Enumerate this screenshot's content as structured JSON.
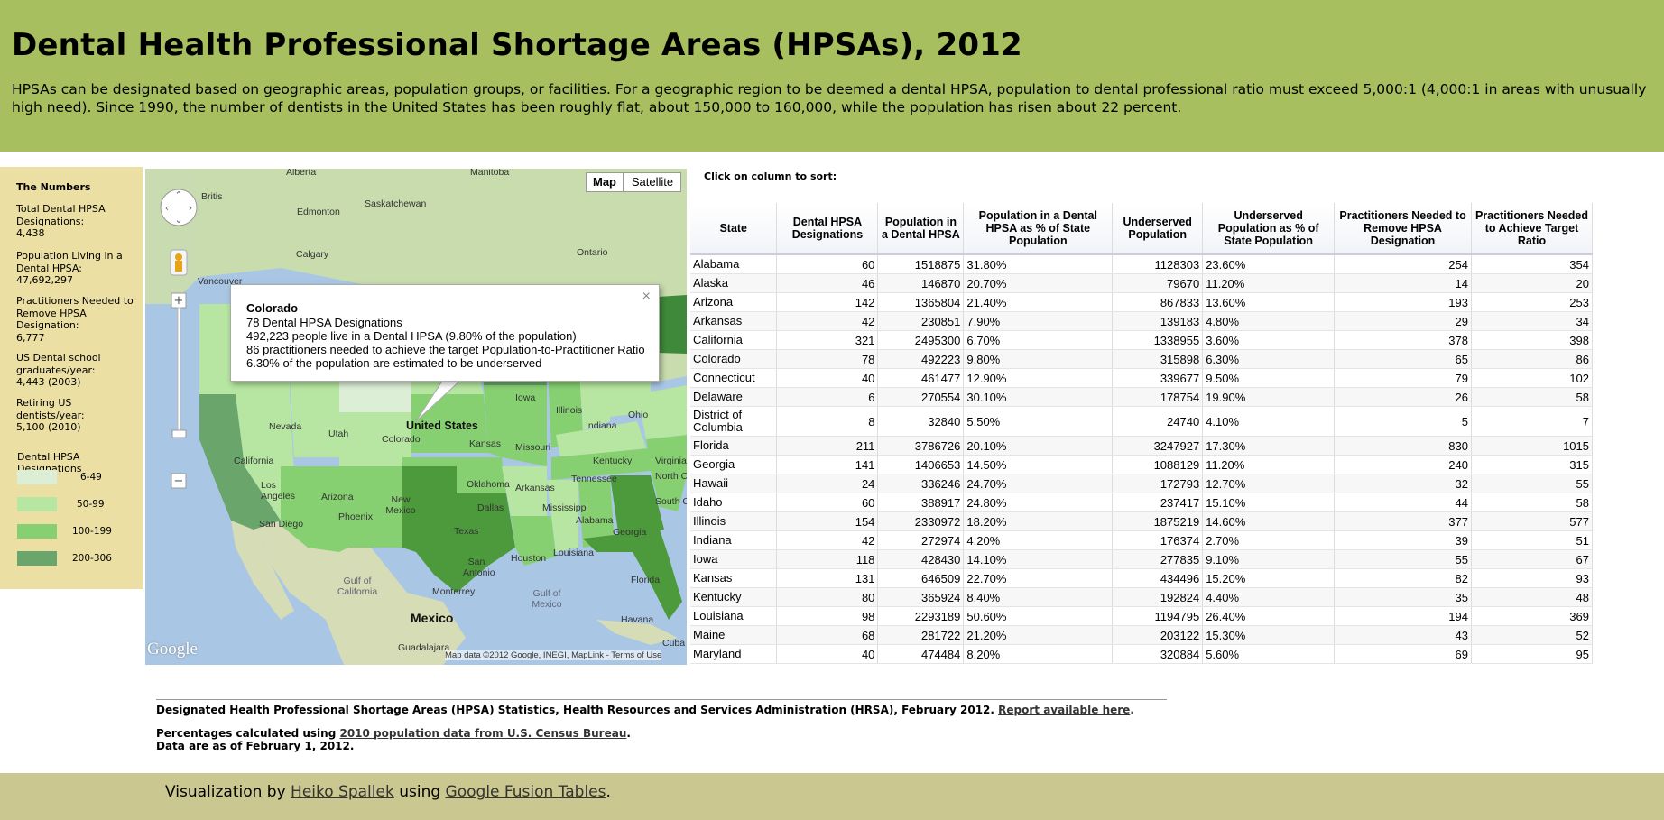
{
  "header": {
    "title": "Dental Health Professional Shortage Areas (HPSAs), 2012",
    "intro": "HPSAs can be designated based on geographic areas, population groups, or facilities. For a geographic region to be deemed a dental HPSA, population to dental professional ratio must exceed 5,000:1 (4,000:1 in areas with unusually high need). Since 1990, the number of dentists in the United States has been roughly flat, about 150,000 to 160,000, while the population has risen about 22 percent."
  },
  "numbers": {
    "heading": "The Numbers",
    "stats": [
      {
        "label": "Total Dental HPSA Designations:",
        "value": "4,438"
      },
      {
        "label": "Population Living in a Dental HPSA:",
        "value": "47,692,297"
      },
      {
        "label": "Practitioners Needed to Remove HPSA Designation:",
        "value": "6,777"
      },
      {
        "label": "US Dental school graduates/year:",
        "value": "4,443 (2003)"
      },
      {
        "label": "Retiring US dentists/year:",
        "value": "5,100 (2010)"
      }
    ],
    "legend": {
      "title": "Dental HPSA Designations",
      "items": [
        {
          "label": "6-49",
          "color": "#dcefd6"
        },
        {
          "label": "50-99",
          "color": "#b6e6a1"
        },
        {
          "label": "100-199",
          "color": "#87d071"
        },
        {
          "label": "200-306",
          "color": "#6aa56b"
        }
      ]
    }
  },
  "map": {
    "type_buttons": {
      "map": "Map",
      "satellite": "Satellite"
    },
    "labels": [
      "Alberta",
      "Manitoba",
      "Saskatchewan",
      "Edmonton",
      "British Columbia",
      "Calgary",
      "Ontario",
      "Vancouver",
      "Nevada",
      "Utah",
      "Colorado",
      "United States",
      "Kansas",
      "Missouri",
      "Iowa",
      "Illinois",
      "Indiana",
      "Ohio",
      "California",
      "Los Angeles",
      "Arizona",
      "Phoenix",
      "New Mexico",
      "Oklahoma",
      "Arkansas",
      "Tennessee",
      "Kentucky",
      "Virginia",
      "North Carolina",
      "South Carolina",
      "Mississippi",
      "Alabama",
      "Georgia",
      "Louisiana",
      "Texas",
      "Dallas",
      "San Antonio",
      "Houston",
      "Florida",
      "San Diego",
      "Gulf of California",
      "Monterrey",
      "Gulf of Mexico",
      "Mexico",
      "Havana",
      "Guadalajara",
      "Cuba"
    ],
    "attribution": "Map data ©2012 Google, INEGI, MapLink - ",
    "terms": "Terms of Use",
    "logo": "Google",
    "info_window": {
      "title": "Colorado",
      "lines": [
        "78 Dental HPSA Designations",
        "492,223 people live in a Dental HPSA (9.80% of the population)",
        "86 practitioners needed to achieve the target Population-to-Practitioner Ratio",
        "6.30% of the population are estimated to be underserved"
      ],
      "close": "×"
    }
  },
  "table": {
    "sort_hint": "Click on column to sort:",
    "columns": [
      "State",
      "Dental HPSA Designations",
      "Population in a Dental HPSA",
      "Population in a Dental HPSA as % of State Population",
      "Underserved Population",
      "Underserved Population as % of State Population",
      "Practitioners Needed to Remove HPSA Designation",
      "Practitioners Needed to Achieve Target Ratio"
    ],
    "rows": [
      [
        "Alabama",
        "60",
        "1518875",
        "31.80%",
        "1128303",
        "23.60%",
        "254",
        "354"
      ],
      [
        "Alaska",
        "46",
        "146870",
        "20.70%",
        "79670",
        "11.20%",
        "14",
        "20"
      ],
      [
        "Arizona",
        "142",
        "1365804",
        "21.40%",
        "867833",
        "13.60%",
        "193",
        "253"
      ],
      [
        "Arkansas",
        "42",
        "230851",
        "7.90%",
        "139183",
        "4.80%",
        "29",
        "34"
      ],
      [
        "California",
        "321",
        "2495300",
        "6.70%",
        "1338955",
        "3.60%",
        "378",
        "398"
      ],
      [
        "Colorado",
        "78",
        "492223",
        "9.80%",
        "315898",
        "6.30%",
        "65",
        "86"
      ],
      [
        "Connecticut",
        "40",
        "461477",
        "12.90%",
        "339677",
        "9.50%",
        "79",
        "102"
      ],
      [
        "Delaware",
        "6",
        "270554",
        "30.10%",
        "178754",
        "19.90%",
        "26",
        "58"
      ],
      [
        "District of Columbia",
        "8",
        "32840",
        "5.50%",
        "24740",
        "4.10%",
        "5",
        "7"
      ],
      [
        "Florida",
        "211",
        "3786726",
        "20.10%",
        "3247927",
        "17.30%",
        "830",
        "1015"
      ],
      [
        "Georgia",
        "141",
        "1406653",
        "14.50%",
        "1088129",
        "11.20%",
        "240",
        "315"
      ],
      [
        "Hawaii",
        "24",
        "336246",
        "24.70%",
        "172793",
        "12.70%",
        "32",
        "55"
      ],
      [
        "Idaho",
        "60",
        "388917",
        "24.80%",
        "237417",
        "15.10%",
        "44",
        "58"
      ],
      [
        "Illinois",
        "154",
        "2330972",
        "18.20%",
        "1875219",
        "14.60%",
        "377",
        "577"
      ],
      [
        "Indiana",
        "42",
        "272974",
        "4.20%",
        "176374",
        "2.70%",
        "39",
        "51"
      ],
      [
        "Iowa",
        "118",
        "428430",
        "14.10%",
        "277835",
        "9.10%",
        "55",
        "67"
      ],
      [
        "Kansas",
        "131",
        "646509",
        "22.70%",
        "434496",
        "15.20%",
        "82",
        "93"
      ],
      [
        "Kentucky",
        "80",
        "365924",
        "8.40%",
        "192824",
        "4.40%",
        "35",
        "48"
      ],
      [
        "Louisiana",
        "98",
        "2293189",
        "50.60%",
        "1194795",
        "26.40%",
        "194",
        "369"
      ],
      [
        "Maine",
        "68",
        "281722",
        "21.20%",
        "203122",
        "15.30%",
        "43",
        "52"
      ],
      [
        "Maryland",
        "40",
        "474484",
        "8.20%",
        "320884",
        "5.60%",
        "69",
        "95"
      ]
    ]
  },
  "sources": {
    "line1": "Designated Health Professional Shortage Areas (HPSA) Statistics, Health Resources and Services Administration (HRSA), February 2012.",
    "line1_link": "Report available here",
    "line2_prefix": "Percentages calculated using",
    "line2_link": "2010 population data from U.S. Census Bureau",
    "line3": "Data are as of February 1, 2012."
  },
  "footer": {
    "prefix": "Visualization by",
    "author": "Heiko Spallek",
    "middle": "using",
    "tool": "Google Fusion Tables"
  }
}
